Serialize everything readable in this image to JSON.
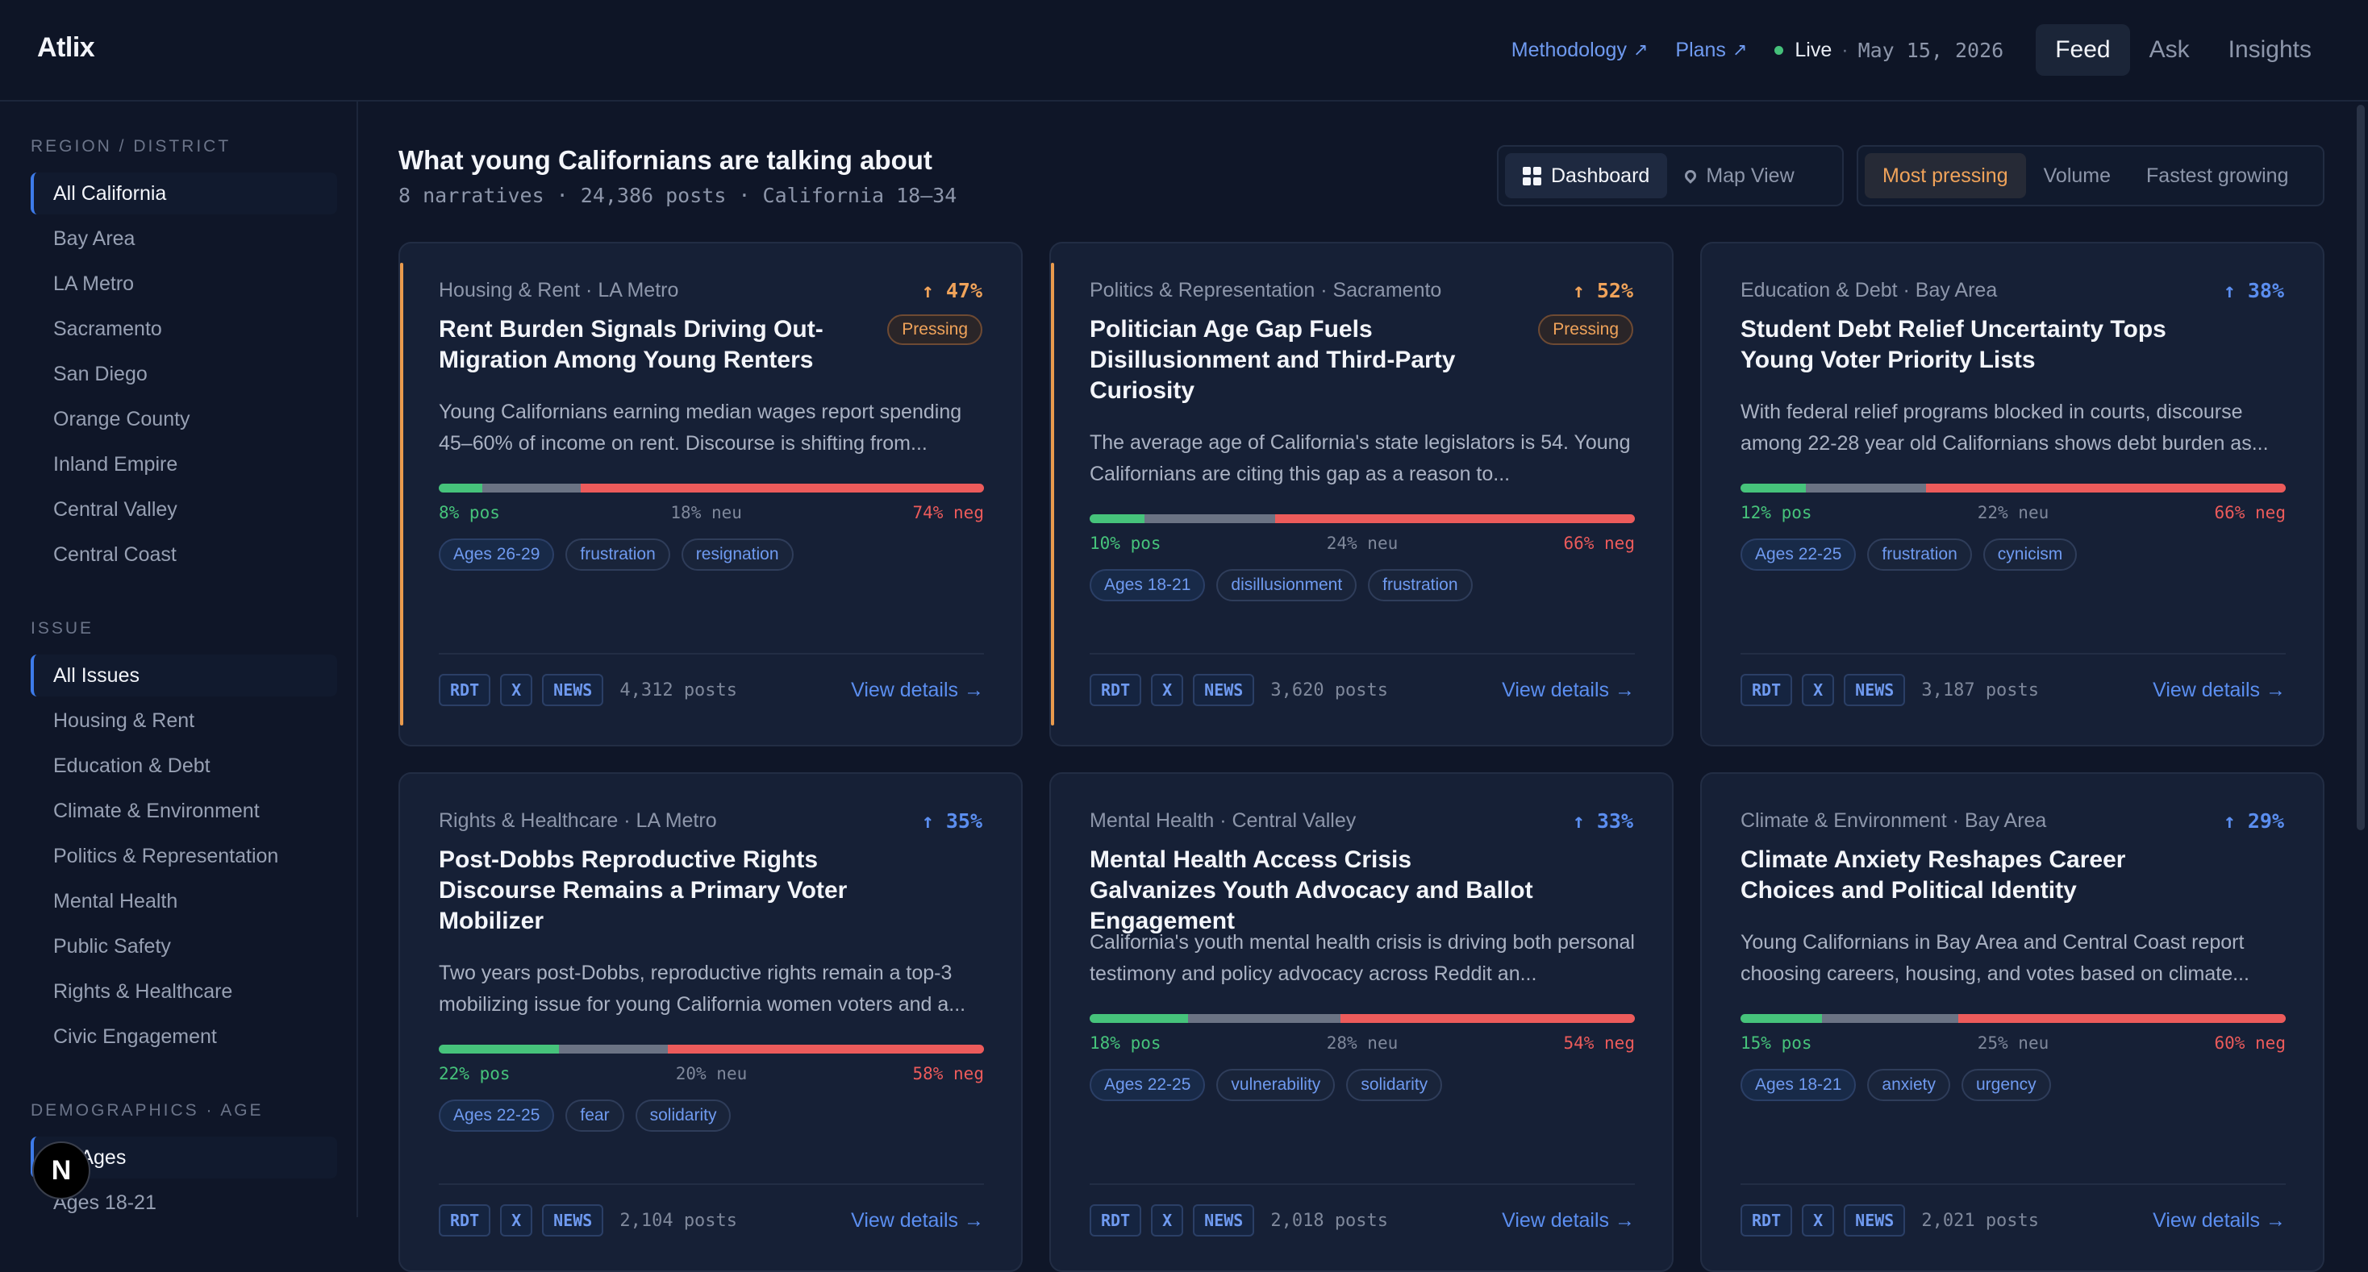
{
  "app": {
    "brand": "Atlix",
    "links": [
      {
        "label": "Methodology",
        "arrow": "↗"
      },
      {
        "label": "Plans",
        "arrow": "↗"
      }
    ],
    "live_label": "Live",
    "live_sep": "·",
    "date": "May 15, 2026",
    "nav_tabs": [
      "Feed",
      "Ask",
      "Insights"
    ]
  },
  "sidebar": {
    "region_title": "REGION / DISTRICT",
    "regions": [
      "All California",
      "Bay Area",
      "LA Metro",
      "Sacramento",
      "San Diego",
      "Orange County",
      "Inland Empire",
      "Central Valley",
      "Central Coast"
    ],
    "issue_title": "ISSUE",
    "issues": [
      "All Issues",
      "Housing & Rent",
      "Education & Debt",
      "Climate & Environment",
      "Politics & Representation",
      "Mental Health",
      "Public Safety",
      "Rights & Healthcare",
      "Civic Engagement"
    ],
    "demo_title": "DEMOGRAPHICS · AGE",
    "ages": [
      "All Ages",
      "Ages 18-21"
    ]
  },
  "header": {
    "title": "What young Californians are talking about",
    "subtitle": "8 narratives · 24,386 posts · California 18–34",
    "view_tabs": [
      "Dashboard",
      "Map View"
    ],
    "sort_tabs": [
      "Most pressing",
      "Volume",
      "Fastest growing"
    ]
  },
  "colors": {
    "accent": "#5b8ef0",
    "pressing": "#f0a35a",
    "positive": "#46c37b",
    "negative": "#ec5b5b"
  },
  "cards": [
    {
      "category": "Housing & Rent · LA Metro",
      "trend": "↑ 47%",
      "badge": "Pressing",
      "title": "Rent Burden Signals Driving Out-Migration Among Young Renters",
      "desc": "Young Californians earning median wages report spending 45–60% of income on rent. Discourse is shifting from...",
      "pos": 8,
      "neu": 18,
      "neg": 74,
      "pos_label": "8% pos",
      "neu_label": "18% neu",
      "neg_label": "74% neg",
      "tags": [
        "Ages 26-29",
        "frustration",
        "resignation"
      ],
      "sources": [
        "RDT",
        "X",
        "NEWS"
      ],
      "posts": "4,312 posts",
      "cta": "View details →"
    },
    {
      "category": "Politics & Representation · Sacramento",
      "trend": "↑ 52%",
      "badge": "Pressing",
      "title": "Politician Age Gap Fuels Disillusionment and Third-Party Curiosity",
      "desc": "The average age of California's state legislators is 54. Young Californians are citing this gap as a reason to...",
      "pos": 10,
      "neu": 24,
      "neg": 66,
      "pos_label": "10% pos",
      "neu_label": "24% neu",
      "neg_label": "66% neg",
      "tags": [
        "Ages 18-21",
        "disillusionment",
        "frustration"
      ],
      "sources": [
        "RDT",
        "X",
        "NEWS"
      ],
      "posts": "3,620 posts",
      "cta": "View details →"
    },
    {
      "category": "Education & Debt · Bay Area",
      "trend": "↑ 38%",
      "badge": "",
      "title": "Student Debt Relief Uncertainty Tops Young Voter Priority Lists",
      "desc": "With federal relief programs blocked in courts, discourse among 22-28 year old Californians shows debt burden as...",
      "pos": 12,
      "neu": 22,
      "neg": 66,
      "pos_label": "12% pos",
      "neu_label": "22% neu",
      "neg_label": "66% neg",
      "tags": [
        "Ages 22-25",
        "frustration",
        "cynicism"
      ],
      "sources": [
        "RDT",
        "X",
        "NEWS"
      ],
      "posts": "3,187 posts",
      "cta": "View details →"
    },
    {
      "category": "Rights & Healthcare · LA Metro",
      "trend": "↑ 35%",
      "badge": "",
      "title": "Post-Dobbs Reproductive Rights Discourse Remains a Primary Voter Mobilizer",
      "desc": "Two years post-Dobbs, reproductive rights remain a top-3 mobilizing issue for young California women voters and a...",
      "pos": 22,
      "neu": 20,
      "neg": 58,
      "pos_label": "22% pos",
      "neu_label": "20% neu",
      "neg_label": "58% neg",
      "tags": [
        "Ages 22-25",
        "fear",
        "solidarity"
      ],
      "sources": [
        "RDT",
        "X",
        "NEWS"
      ],
      "posts": "2,104 posts",
      "cta": "View details →"
    },
    {
      "category": "Mental Health · Central Valley",
      "trend": "↑ 33%",
      "badge": "",
      "title": "Mental Health Access Crisis Galvanizes Youth Advocacy and Ballot Engagement",
      "desc": "California's youth mental health crisis is driving both personal testimony and policy advocacy across Reddit an...",
      "pos": 18,
      "neu": 28,
      "neg": 54,
      "pos_label": "18% pos",
      "neu_label": "28% neu",
      "neg_label": "54% neg",
      "tags": [
        "Ages 22-25",
        "vulnerability",
        "solidarity"
      ],
      "sources": [
        "RDT",
        "X",
        "NEWS"
      ],
      "posts": "2,018 posts",
      "cta": "View details →"
    },
    {
      "category": "Climate & Environment · Bay Area",
      "trend": "↑ 29%",
      "badge": "",
      "title": "Climate Anxiety Reshapes Career Choices and Political Identity",
      "desc": "Young Californians in Bay Area and Central Coast report choosing careers, housing, and votes based on climate...",
      "pos": 15,
      "neu": 25,
      "neg": 60,
      "pos_label": "15% pos",
      "neu_label": "25% neu",
      "neg_label": "60% neg",
      "tags": [
        "Ages 18-21",
        "anxiety",
        "urgency"
      ],
      "sources": [
        "RDT",
        "X",
        "NEWS"
      ],
      "posts": "2,021 posts",
      "cta": "View details →"
    }
  ],
  "floating_badge": "N"
}
